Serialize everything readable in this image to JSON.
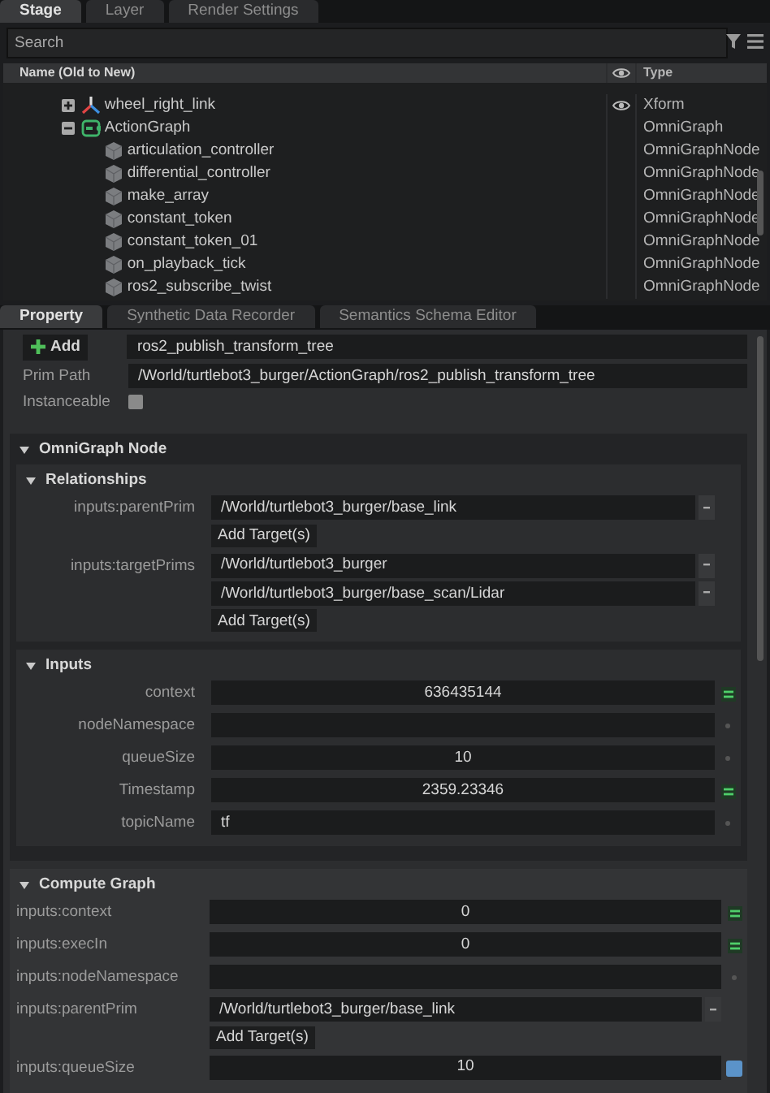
{
  "stage_tabs": [
    {
      "label": "Stage",
      "selected": true
    },
    {
      "label": "Layer",
      "selected": false
    },
    {
      "label": "Render Settings",
      "selected": false
    }
  ],
  "search": {
    "placeholder": "Search"
  },
  "tree": {
    "columns": [
      "Name (Old to New)",
      "Type"
    ],
    "rows": [
      {
        "name": "wheel_right_link",
        "type": "Xform",
        "kind": "xform",
        "visible": true,
        "expanded": false
      },
      {
        "name": "ActionGraph",
        "type": "OmniGraph",
        "kind": "graph",
        "visible": false,
        "expanded": true,
        "children": [
          {
            "name": "articulation_controller",
            "type": "OmniGraphNode",
            "kind": "node",
            "visible": false
          },
          {
            "name": "differential_controller",
            "type": "OmniGraphNode",
            "kind": "node",
            "visible": false
          },
          {
            "name": "make_array",
            "type": "OmniGraphNode",
            "kind": "node",
            "visible": false
          },
          {
            "name": "constant_token",
            "type": "OmniGraphNode",
            "kind": "node",
            "visible": false
          },
          {
            "name": "constant_token_01",
            "type": "OmniGraphNode",
            "kind": "node",
            "visible": false
          },
          {
            "name": "on_playback_tick",
            "type": "OmniGraphNode",
            "kind": "node",
            "visible": false
          },
          {
            "name": "ros2_subscribe_twist",
            "type": "OmniGraphNode",
            "kind": "node",
            "visible": false
          }
        ]
      }
    ]
  },
  "property_tabs": [
    {
      "label": "Property",
      "selected": true
    },
    {
      "label": "Synthetic Data Recorder",
      "selected": false
    },
    {
      "label": "Semantics Schema Editor",
      "selected": false
    }
  ],
  "property": {
    "add_label": "Add",
    "name_value": "ros2_publish_transform_tree",
    "prim_path_label": "Prim Path",
    "prim_path_value": "/World/turtlebot3_burger/ActionGraph/ros2_publish_transform_tree",
    "instanceable_label": "Instanceable",
    "instanceable_checked": false
  },
  "sections": [
    {
      "title": "OmniGraph Node",
      "expanded": true,
      "subsections": [
        {
          "title": "Relationships",
          "expanded": true,
          "items": [
            {
              "kind": "relationship",
              "label": "inputs:parentPrim",
              "targets": [
                "/World/turtlebot3_burger/base_link"
              ],
              "add_label": "Add Target(s)"
            },
            {
              "kind": "relationship",
              "label": "inputs:targetPrims",
              "targets": [
                "/World/turtlebot3_burger",
                "/World/turtlebot3_burger/base_scan/Lidar"
              ],
              "add_label": "Add Target(s)"
            }
          ]
        },
        {
          "title": "Inputs",
          "expanded": true,
          "items": [
            {
              "kind": "number",
              "label": "context",
              "value": "636435144",
              "connected": true,
              "modified": false
            },
            {
              "kind": "text",
              "label": "nodeNamespace",
              "connected": false,
              "modified": false
            },
            {
              "kind": "number",
              "label": "queueSize",
              "value": "10",
              "connected": false,
              "modified": false
            },
            {
              "kind": "number",
              "label": "Timestamp",
              "value": "2359.23346",
              "connected": true,
              "modified": false
            },
            {
              "kind": "text",
              "label": "topicName",
              "value": "tf",
              "connected": false,
              "modified": false
            }
          ]
        }
      ]
    },
    {
      "title": "Compute Graph",
      "expanded": true,
      "items": [
        {
          "kind": "number",
          "label": "inputs:context",
          "value": "0",
          "connected": true,
          "modified": false
        },
        {
          "kind": "number",
          "label": "inputs:execIn",
          "value": "0",
          "connected": true,
          "modified": false
        },
        {
          "kind": "text",
          "label": "inputs:nodeNamespace",
          "connected": false,
          "modified": false
        },
        {
          "kind": "relationship",
          "label": "inputs:parentPrim",
          "targets": [
            "/World/turtlebot3_burger/base_link"
          ],
          "add_label": "Add Target(s)"
        },
        {
          "kind": "number",
          "label": "inputs:queueSize",
          "value": "10",
          "connected": false,
          "modified": true
        }
      ]
    }
  ]
}
